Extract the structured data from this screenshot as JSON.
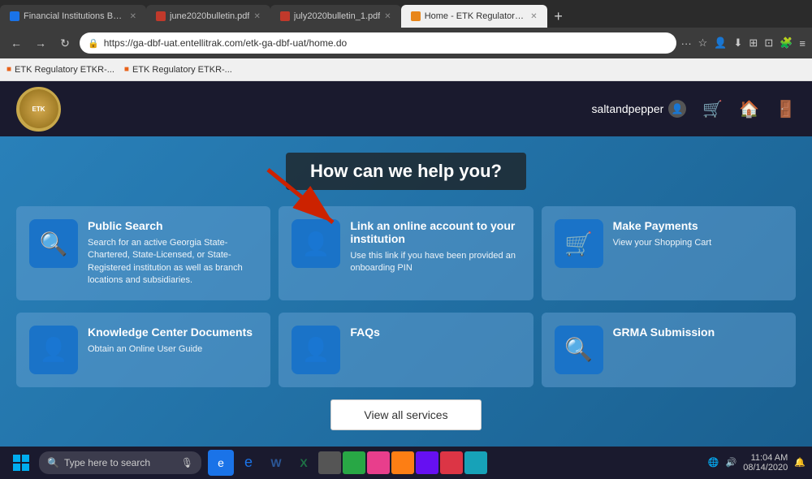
{
  "browser": {
    "tabs": [
      {
        "id": "tab1",
        "label": "Financial Institutions Bulletin - C...",
        "favicon": "blue",
        "active": false
      },
      {
        "id": "tab2",
        "label": "june2020bulletin.pdf",
        "favicon": "red",
        "active": false
      },
      {
        "id": "tab3",
        "label": "july2020bulletin_1.pdf",
        "favicon": "red",
        "active": false
      },
      {
        "id": "tab4",
        "label": "Home - ETK Regulatory ETKR-...",
        "favicon": "orange",
        "active": true
      }
    ],
    "address": "https://ga-dbf-uat.entellitrak.com/etk-ga-dbf-uat/home.do",
    "bookmarks": [
      {
        "label": "ETK Regulatory ETKR-..."
      },
      {
        "label": "ETK Regulatory ETKR-..."
      }
    ]
  },
  "header": {
    "username": "saltandpepper",
    "logo_alt": "ETK Logo"
  },
  "hero": {
    "title": "How can we help you?"
  },
  "cards": [
    {
      "id": "public-search",
      "title": "Public Search",
      "desc": "Search for an active Georgia State-Chartered, State-Licensed, or State-Registered institution as well as branch locations and subsidiaries.",
      "icon": "search"
    },
    {
      "id": "link-account",
      "title": "Link an online account to your institution",
      "desc": "Use this link if you have been provided an onboarding PIN",
      "icon": "person-card"
    },
    {
      "id": "make-payments",
      "title": "Make Payments",
      "desc": "View your Shopping Cart",
      "icon": "cart"
    },
    {
      "id": "knowledge-center",
      "title": "Knowledge Center Documents",
      "desc": "Obtain an Online User Guide",
      "icon": "person-card"
    },
    {
      "id": "faqs",
      "title": "FAQs",
      "desc": "",
      "icon": "person-card"
    },
    {
      "id": "grma-submission",
      "title": "GRMA Submission",
      "desc": "",
      "icon": "search"
    }
  ],
  "view_all_btn": "View all services",
  "taskbar": {
    "search_placeholder": "Type here to search",
    "time": "11:04 AM",
    "date": "08/14/2020"
  }
}
